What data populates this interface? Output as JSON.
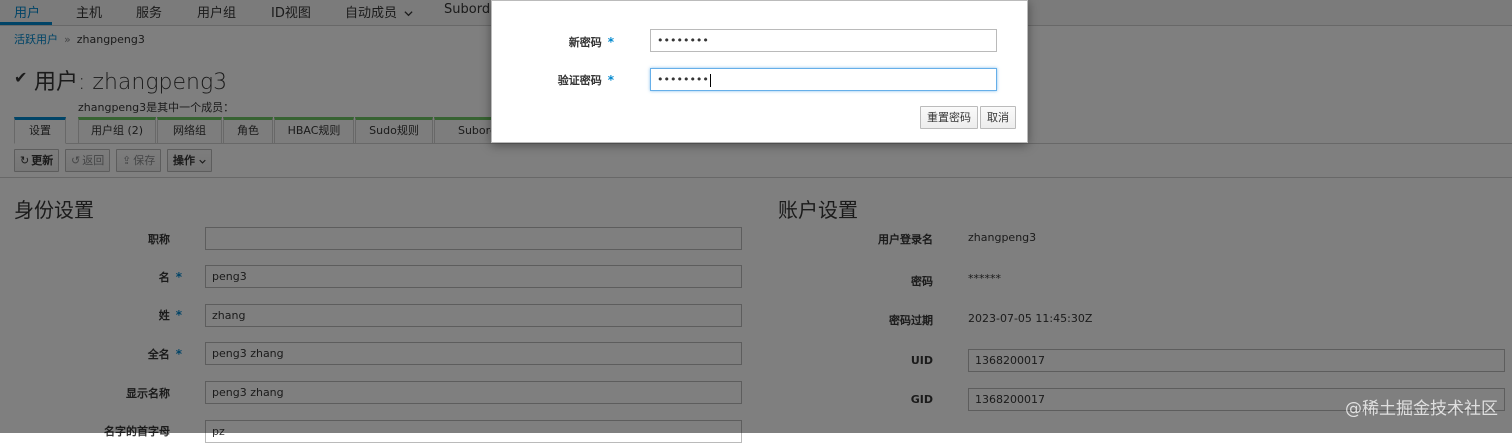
{
  "nav": {
    "items": [
      "用户",
      "主机",
      "服务",
      "用户组",
      "ID视图",
      "自动成员",
      "Subordi"
    ],
    "dropdown_icon": "chevron-down-icon"
  },
  "breadcrumb": {
    "parent": "活跃用户",
    "separator": "»",
    "current": "zhangpeng3"
  },
  "page": {
    "check_icon": "✔",
    "title": "用户: zhangpeng3",
    "member_note": "zhangpeng3是其中一个成员："
  },
  "tabs": [
    "设置",
    "用户组 (2)",
    "网络组",
    "角色",
    "HBAC规则",
    "Sudo规则",
    "Subordi"
  ],
  "toolbar": {
    "refresh": "更新",
    "revert": "返回",
    "save": "保存",
    "actions": "操作"
  },
  "identity": {
    "title": "身份设置",
    "fields": [
      {
        "label": "职称",
        "value": "",
        "required": false
      },
      {
        "label": "名",
        "value": "peng3",
        "required": true
      },
      {
        "label": "姓",
        "value": "zhang",
        "required": true
      },
      {
        "label": "全名",
        "value": "peng3 zhang",
        "required": true
      },
      {
        "label": "显示名称",
        "value": "peng3 zhang",
        "required": false
      },
      {
        "label": "名字的首字母",
        "value": "pz",
        "required": false
      }
    ]
  },
  "account": {
    "title": "账户设置",
    "login_label": "用户登录名",
    "login_value": "zhangpeng3",
    "password_label": "密码",
    "password_value": "******",
    "expiry_label": "密码过期",
    "expiry_value": "2023-07-05 11:45:30Z",
    "uid_label": "UID",
    "uid_value": "1368200017",
    "gid_label": "GID",
    "gid_value": "1368200017"
  },
  "required_mark": "*",
  "modal": {
    "new_password_label": "新密码",
    "new_password_value": "••••••••",
    "verify_password_label": "验证密码",
    "verify_password_value": "••••••••",
    "reset_button": "重置密码",
    "cancel_button": "取消"
  },
  "watermark": "@稀土掘金技术社区",
  "colors": {
    "accent": "#0088ce",
    "required": "#0088ce",
    "overlay": "rgba(0,0,0,0.5)"
  }
}
